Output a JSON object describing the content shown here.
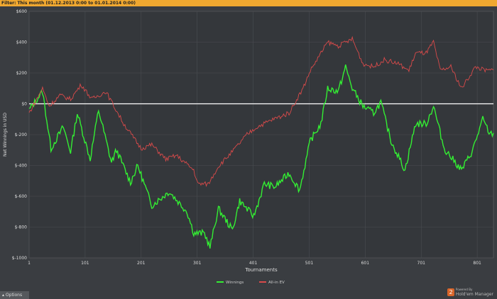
{
  "filter": {
    "label": "Filter:",
    "value": "This month (01.12.2013 0:00 to 01.01.2014 0:00)"
  },
  "options_label": "Options",
  "brand": {
    "logo": "2",
    "powered": "Powered By",
    "name": "Hold'em Manager"
  },
  "chart_data": {
    "type": "line",
    "xlabel": "Tournaments",
    "ylabel": "Net Winnings in USD",
    "xlim": [
      1,
      830
    ],
    "ylim": [
      -1000,
      600
    ],
    "xticks": [
      1,
      101,
      201,
      301,
      401,
      501,
      601,
      701,
      801
    ],
    "yticks": [
      600,
      400,
      200,
      0,
      -200,
      -400,
      -600,
      -800,
      -1000
    ],
    "ytick_labels": [
      "$600",
      "$400",
      "$200",
      "$0",
      "$-200",
      "$-400",
      "$-600",
      "$-800",
      "$-1000"
    ],
    "grid": true,
    "legend": "bottom-center",
    "series": [
      {
        "name": "Winnings",
        "color": "#33ee33",
        "points": [
          [
            1,
            -40
          ],
          [
            25,
            80
          ],
          [
            40,
            -290
          ],
          [
            62,
            -150
          ],
          [
            75,
            -310
          ],
          [
            87,
            -60
          ],
          [
            110,
            -360
          ],
          [
            125,
            -40
          ],
          [
            148,
            -380
          ],
          [
            157,
            -300
          ],
          [
            182,
            -510
          ],
          [
            195,
            -400
          ],
          [
            220,
            -660
          ],
          [
            251,
            -570
          ],
          [
            283,
            -700
          ],
          [
            295,
            -840
          ],
          [
            314,
            -840
          ],
          [
            324,
            -930
          ],
          [
            339,
            -680
          ],
          [
            364,
            -820
          ],
          [
            377,
            -630
          ],
          [
            402,
            -730
          ],
          [
            421,
            -520
          ],
          [
            440,
            -540
          ],
          [
            465,
            -450
          ],
          [
            484,
            -560
          ],
          [
            503,
            -240
          ],
          [
            522,
            -130
          ],
          [
            534,
            100
          ],
          [
            553,
            80
          ],
          [
            566,
            240
          ],
          [
            578,
            100
          ],
          [
            597,
            -15
          ],
          [
            616,
            -60
          ],
          [
            629,
            10
          ],
          [
            647,
            -240
          ],
          [
            672,
            -430
          ],
          [
            691,
            -130
          ],
          [
            710,
            -130
          ],
          [
            723,
            -15
          ],
          [
            742,
            -290
          ],
          [
            773,
            -430
          ],
          [
            792,
            -310
          ],
          [
            811,
            -100
          ],
          [
            824,
            -200
          ],
          [
            830,
            -190
          ]
        ]
      },
      {
        "name": "All-in EV",
        "color": "#d94a4a",
        "points": [
          [
            1,
            -60
          ],
          [
            25,
            100
          ],
          [
            37,
            -15
          ],
          [
            56,
            55
          ],
          [
            75,
            30
          ],
          [
            94,
            125
          ],
          [
            113,
            30
          ],
          [
            138,
            80
          ],
          [
            170,
            -130
          ],
          [
            201,
            -290
          ],
          [
            220,
            -265
          ],
          [
            245,
            -360
          ],
          [
            264,
            -335
          ],
          [
            295,
            -430
          ],
          [
            302,
            -520
          ],
          [
            321,
            -520
          ],
          [
            339,
            -405
          ],
          [
            364,
            -310
          ],
          [
            390,
            -200
          ],
          [
            408,
            -150
          ],
          [
            434,
            -105
          ],
          [
            465,
            -60
          ],
          [
            490,
            100
          ],
          [
            503,
            215
          ],
          [
            534,
            400
          ],
          [
            553,
            375
          ],
          [
            578,
            420
          ],
          [
            597,
            260
          ],
          [
            616,
            240
          ],
          [
            635,
            285
          ],
          [
            660,
            260
          ],
          [
            679,
            215
          ],
          [
            691,
            330
          ],
          [
            710,
            330
          ],
          [
            723,
            400
          ],
          [
            735,
            215
          ],
          [
            754,
            240
          ],
          [
            773,
            100
          ],
          [
            798,
            240
          ],
          [
            817,
            215
          ],
          [
            830,
            220
          ]
        ]
      }
    ]
  }
}
